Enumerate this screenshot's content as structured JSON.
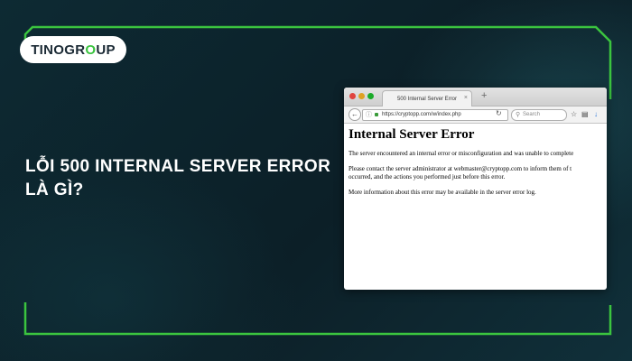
{
  "brand": {
    "logo_part1": "TINO",
    "logo_part2": "GR",
    "logo_o": "O",
    "logo_part3": "UP",
    "accent": "#3bc43f"
  },
  "headline": {
    "line1": "LỖI 500 INTERNAL SERVER ERROR",
    "line2": "LÀ GÌ?"
  },
  "browser": {
    "tab_title": "500 Internal Server Error",
    "tab_close": "×",
    "new_tab": "+",
    "url": "https://cryptopp.com/w/index.php",
    "search_placeholder": "Search",
    "page": {
      "title": "Internal Server Error",
      "p1": "The server encountered an internal error or misconfiguration and was unable to complete",
      "p2_line1": "Please contact the server administrator at webmaster@cryptopp.com to inform them of t",
      "p2_line2": "occurred, and the actions you performed just before this error.",
      "p3": "More information about this error may be available in the server error log."
    }
  }
}
